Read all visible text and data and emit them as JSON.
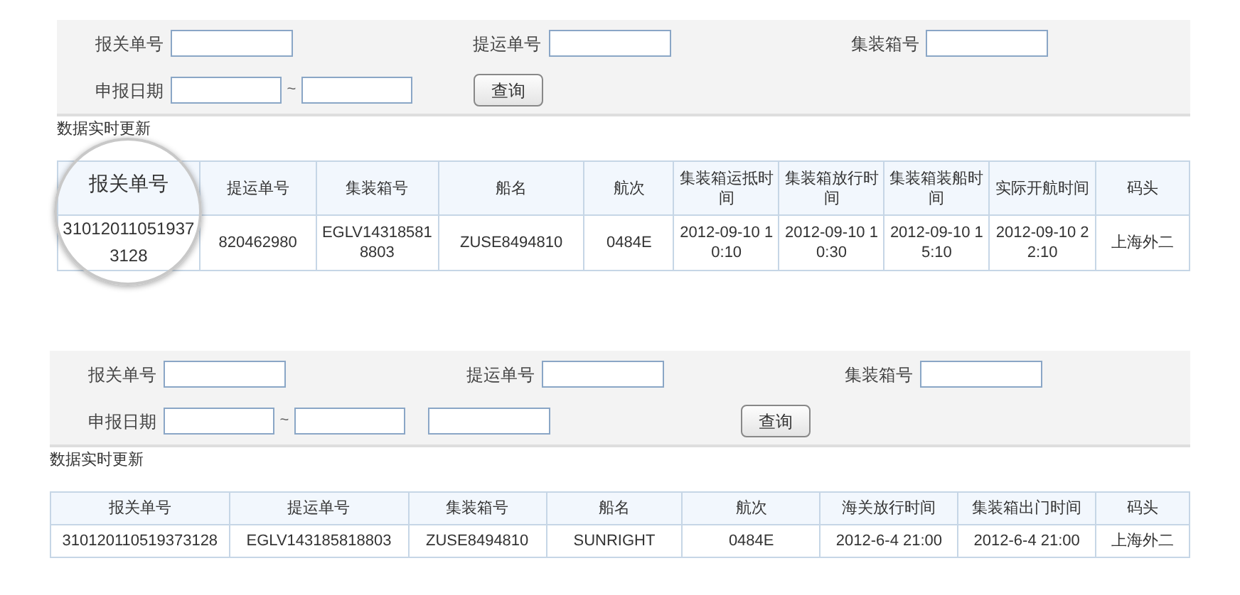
{
  "panels": [
    {
      "magnifier": true,
      "filters": [
        [
          {
            "kind": "field",
            "label": "报关单号"
          },
          {
            "kind": "field",
            "label": "提运单号"
          },
          {
            "kind": "field",
            "label": "集装箱号"
          }
        ],
        [
          {
            "kind": "date_range",
            "label": "申报日期",
            "separator": "~"
          },
          {
            "kind": "button",
            "label": "查询"
          }
        ]
      ],
      "caption": "数据实时更新",
      "table": {
        "columns": [
          "报关单号",
          "提运单号",
          "集装箱号",
          "船名",
          "航次",
          "集装箱运抵时间",
          "集装箱放行时间",
          "集装箱装船时间",
          "实际开航时间",
          "码头"
        ],
        "rows": [
          [
            "310120110519373128",
            "820462980",
            "EGLV143185818803",
            "ZUSE8494810",
            "0484E",
            "2012-09-10 10:10",
            "2012-09-10 10:30",
            "2012-09-10 15:10",
            "2012-09-10 22:10",
            "上海外二"
          ]
        ]
      }
    },
    {
      "magnifier": false,
      "filters": [
        [
          {
            "kind": "field",
            "label": "报关单号"
          },
          {
            "kind": "field",
            "label": "提运单号"
          },
          {
            "kind": "field",
            "label": "集装箱号"
          }
        ],
        [
          {
            "kind": "date_range",
            "label": "申报日期",
            "separator": "~"
          },
          {
            "kind": "field"
          },
          {
            "kind": "button",
            "label": "查询"
          }
        ]
      ],
      "caption": "数据实时更新",
      "table": {
        "columns": [
          "报关单号",
          "提运单号",
          "集装箱号",
          "船名",
          "航次",
          "海关放行时间",
          "集装箱出门时间",
          "码头"
        ],
        "rows": [
          [
            "310120110519373128",
            "EGLV143185818803",
            "ZUSE8494810",
            "SUNRIGHT",
            "0484E",
            "2012-6-4 21:00",
            "2012-6-4 21:00",
            "上海外二"
          ]
        ]
      }
    }
  ]
}
